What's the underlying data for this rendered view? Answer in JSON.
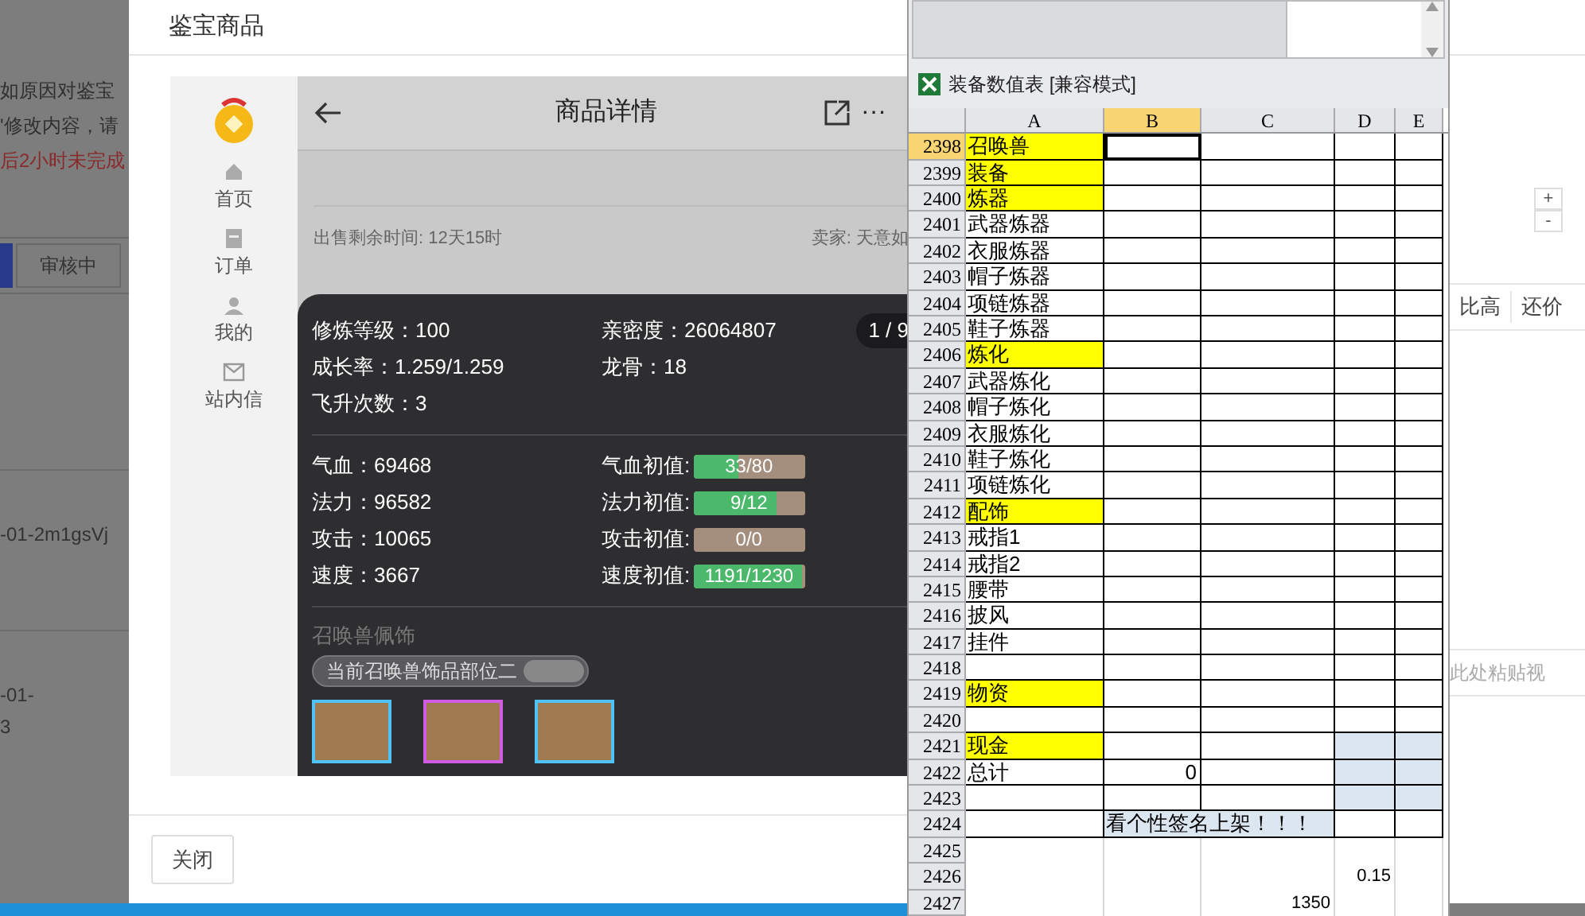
{
  "background_page": {
    "notice_lines": [
      {
        "text": "如原因对鉴宝",
        "kind": "plain"
      },
      {
        "text": "'修改内容，请",
        "kind": "plain"
      },
      {
        "text": "后2小时未完成",
        "kind": "warning"
      }
    ],
    "tabs": [
      {
        "selected": true
      },
      {
        "label": "审核中",
        "selected": false
      }
    ],
    "rows": [
      {
        "lines": [
          "-01-2m1gsVj"
        ]
      },
      {
        "lines": [
          "-01-",
          "3"
        ]
      }
    ]
  },
  "modal": {
    "title": "鉴宝商品",
    "close_button": "关闭",
    "app": {
      "nav": [
        {
          "label": "首页",
          "kind": "home"
        },
        {
          "label": "订单",
          "kind": "order"
        },
        {
          "label": "我的",
          "kind": "user"
        },
        {
          "label": "站内信",
          "kind": "mail"
        }
      ],
      "header_title": "商品详情",
      "more": "···",
      "sale_time": "出售剩余时间: 12天15时",
      "seller": "卖家: 天意如",
      "pager": "1 / 9",
      "basic_stats": [
        [
          "修炼等级：100",
          "亲密度：26064807"
        ],
        [
          "成长率：1.259/1.259",
          "龙骨：18"
        ],
        [
          "飞升次数：3"
        ]
      ],
      "stats": [
        {
          "label": "气血：69468",
          "init_label": "气血初值:",
          "reading": "33/80",
          "level": 0.41
        },
        {
          "label": "法力：96582",
          "init_label": "法力初值:",
          "reading": "9/12",
          "level": 0.75
        },
        {
          "label": "攻击：10065",
          "init_label": "攻击初值:",
          "reading": "0/0",
          "level": 0
        },
        {
          "label": "速度：3667",
          "init_label": "速度初值:",
          "reading": "1191/1230",
          "level": 0.97
        }
      ],
      "accessory_title": "召唤兽佩饰",
      "accessory_tag": "当前召唤兽饰品部位二",
      "items": [
        {
          "color": "#4fc3f7"
        },
        {
          "color": "#d05ce3"
        },
        {
          "color": "#4fc3f7"
        }
      ]
    }
  },
  "spreadsheet": {
    "title": "装备数值表 [兼容模式]",
    "columns": [
      {
        "label": "A",
        "selected": false
      },
      {
        "label": "B",
        "selected": true
      },
      {
        "label": "C",
        "selected": false
      },
      {
        "label": "D",
        "selected": false
      },
      {
        "label": "E",
        "selected": false
      }
    ],
    "rows": [
      {
        "num": "2398",
        "cells": {
          "A": "召唤兽"
        },
        "highlight": true,
        "selected": true,
        "shaded_de": false,
        "merged_bc": false,
        "bordered": true
      },
      {
        "num": "2399",
        "cells": {
          "A": "装备"
        },
        "highlight": true,
        "selected": false,
        "shaded_de": false,
        "merged_bc": false,
        "bordered": true
      },
      {
        "num": "2400",
        "cells": {
          "A": "炼器"
        },
        "highlight": true,
        "selected": false,
        "shaded_de": false,
        "merged_bc": false,
        "bordered": true
      },
      {
        "num": "2401",
        "cells": {
          "A": "武器炼器"
        },
        "highlight": false,
        "selected": false,
        "shaded_de": false,
        "merged_bc": false,
        "bordered": true
      },
      {
        "num": "2402",
        "cells": {
          "A": "衣服炼器"
        },
        "highlight": false,
        "selected": false,
        "shaded_de": false,
        "merged_bc": false,
        "bordered": true
      },
      {
        "num": "2403",
        "cells": {
          "A": "帽子炼器"
        },
        "highlight": false,
        "selected": false,
        "shaded_de": false,
        "merged_bc": false,
        "bordered": true
      },
      {
        "num": "2404",
        "cells": {
          "A": "项链炼器"
        },
        "highlight": false,
        "selected": false,
        "shaded_de": false,
        "merged_bc": false,
        "bordered": true
      },
      {
        "num": "2405",
        "cells": {
          "A": "鞋子炼器"
        },
        "highlight": false,
        "selected": false,
        "shaded_de": false,
        "merged_bc": false,
        "bordered": true
      },
      {
        "num": "2406",
        "cells": {
          "A": "炼化"
        },
        "highlight": true,
        "selected": false,
        "shaded_de": false,
        "merged_bc": false,
        "bordered": true
      },
      {
        "num": "2407",
        "cells": {
          "A": "武器炼化"
        },
        "highlight": false,
        "selected": false,
        "shaded_de": false,
        "merged_bc": false,
        "bordered": true
      },
      {
        "num": "2408",
        "cells": {
          "A": "帽子炼化"
        },
        "highlight": false,
        "selected": false,
        "shaded_de": false,
        "merged_bc": false,
        "bordered": true
      },
      {
        "num": "2409",
        "cells": {
          "A": "衣服炼化"
        },
        "highlight": false,
        "selected": false,
        "shaded_de": false,
        "merged_bc": false,
        "bordered": true
      },
      {
        "num": "2410",
        "cells": {
          "A": "鞋子炼化"
        },
        "highlight": false,
        "selected": false,
        "shaded_de": false,
        "merged_bc": false,
        "bordered": true
      },
      {
        "num": "2411",
        "cells": {
          "A": "项链炼化"
        },
        "highlight": false,
        "selected": false,
        "shaded_de": false,
        "merged_bc": false,
        "bordered": true
      },
      {
        "num": "2412",
        "cells": {
          "A": "配饰"
        },
        "highlight": true,
        "selected": false,
        "shaded_de": false,
        "merged_bc": false,
        "bordered": true
      },
      {
        "num": "2413",
        "cells": {
          "A": "戒指1"
        },
        "highlight": false,
        "selected": false,
        "shaded_de": false,
        "merged_bc": false,
        "bordered": true
      },
      {
        "num": "2414",
        "cells": {
          "A": "戒指2"
        },
        "highlight": false,
        "selected": false,
        "shaded_de": false,
        "merged_bc": false,
        "bordered": true
      },
      {
        "num": "2415",
        "cells": {
          "A": "腰带"
        },
        "highlight": false,
        "selected": false,
        "shaded_de": false,
        "merged_bc": false,
        "bordered": true
      },
      {
        "num": "2416",
        "cells": {
          "A": "披风"
        },
        "highlight": false,
        "selected": false,
        "shaded_de": false,
        "merged_bc": false,
        "bordered": true
      },
      {
        "num": "2417",
        "cells": {
          "A": "挂件"
        },
        "highlight": false,
        "selected": false,
        "shaded_de": false,
        "merged_bc": false,
        "bordered": true
      },
      {
        "num": "2418",
        "cells": {},
        "highlight": false,
        "selected": false,
        "shaded_de": false,
        "merged_bc": false,
        "bordered": true
      },
      {
        "num": "2419",
        "cells": {
          "A": "物资"
        },
        "highlight": true,
        "selected": false,
        "shaded_de": false,
        "merged_bc": false,
        "bordered": true
      },
      {
        "num": "2420",
        "cells": {},
        "highlight": false,
        "selected": false,
        "shaded_de": false,
        "merged_bc": false,
        "bordered": true
      },
      {
        "num": "2421",
        "cells": {
          "A": "现金"
        },
        "highlight": true,
        "selected": false,
        "shaded_de": true,
        "merged_bc": false,
        "bordered": true
      },
      {
        "num": "2422",
        "cells": {
          "A": "总计",
          "B": "0"
        },
        "highlight": false,
        "selected": false,
        "shaded_de": true,
        "merged_bc": false,
        "bordered": true
      },
      {
        "num": "2423",
        "cells": {},
        "highlight": false,
        "selected": false,
        "shaded_de": true,
        "merged_bc": false,
        "bordered": true
      },
      {
        "num": "2424",
        "cells": {
          "B": "看个性签名上架！！！"
        },
        "highlight": false,
        "selected": false,
        "shaded_de": false,
        "merged_bc": true,
        "bordered": true
      },
      {
        "num": "2425",
        "cells": {},
        "highlight": false,
        "selected": false,
        "shaded_de": false,
        "merged_bc": false,
        "bordered": false
      },
      {
        "num": "2426",
        "cells": {
          "D": "0.15"
        },
        "highlight": false,
        "selected": false,
        "shaded_de": false,
        "merged_bc": false,
        "bordered": false
      },
      {
        "num": "2427",
        "cells": {
          "C": "1350"
        },
        "highlight": false,
        "selected": false,
        "shaded_de": false,
        "merged_bc": false,
        "bordered": false
      }
    ]
  },
  "right_page": {
    "stepper": [
      "+",
      "-"
    ],
    "tabs": [
      "比高",
      "还价"
    ],
    "paste_hint": "此处粘贴视"
  }
}
